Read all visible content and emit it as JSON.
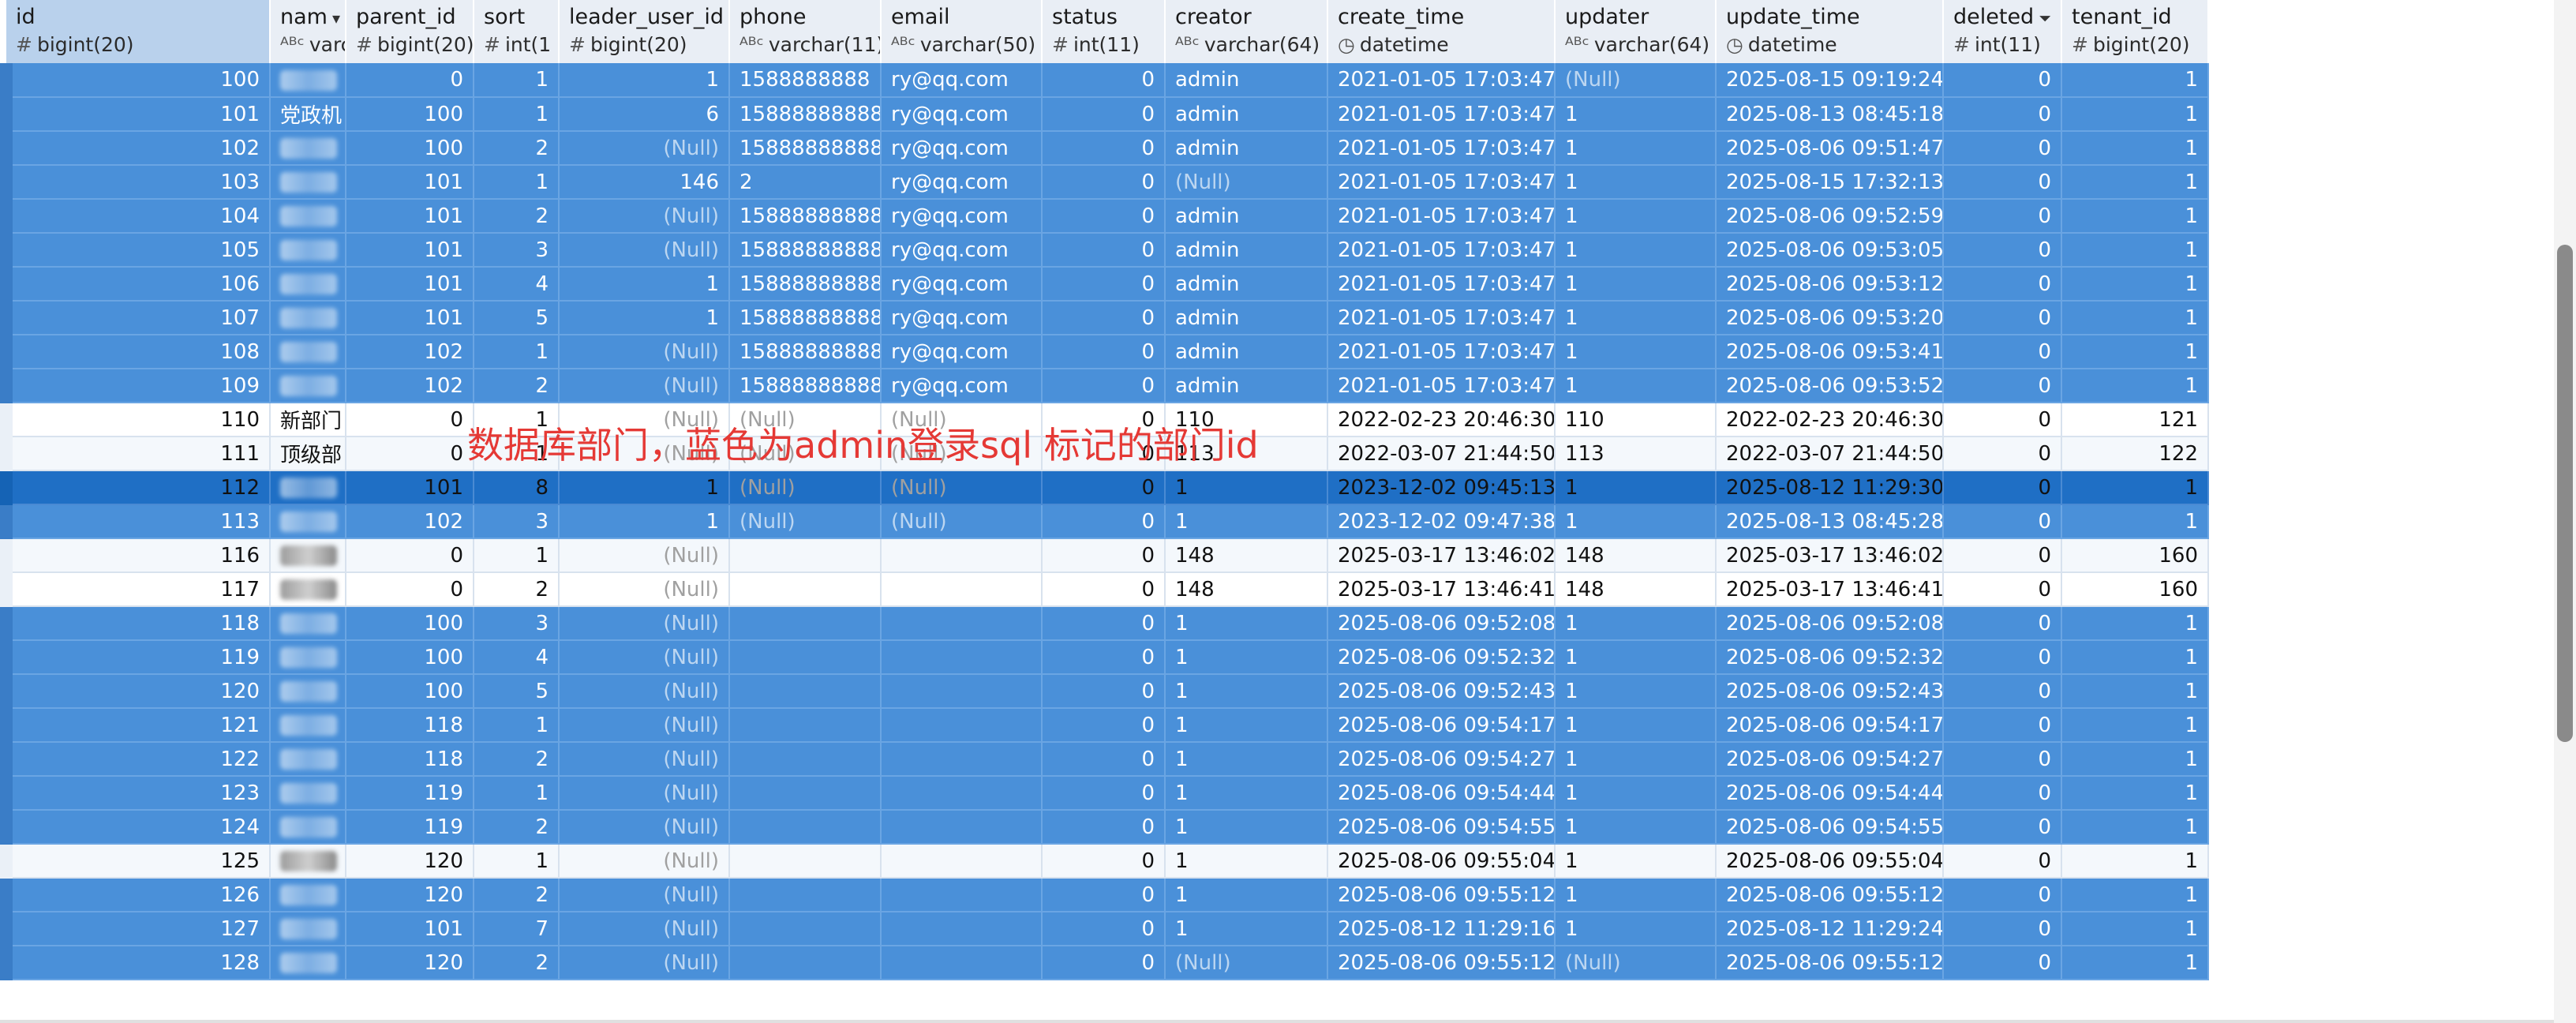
{
  "columns": [
    {
      "name": "id",
      "type": "bigint(20)",
      "type_icon": "#"
    },
    {
      "name": "nam",
      "type": "varc",
      "type_icon": "ABC",
      "sort_indicator": "sort-desc-icon"
    },
    {
      "name": "parent_id",
      "type": "bigint(20)",
      "type_icon": "#"
    },
    {
      "name": "sort",
      "type": "int(1",
      "type_icon": "#"
    },
    {
      "name": "leader_user_id",
      "type": "bigint(20)",
      "type_icon": "#"
    },
    {
      "name": "phone",
      "type": "varchar(11)",
      "type_icon": "ABC"
    },
    {
      "name": "email",
      "type": "varchar(50)",
      "type_icon": "ABC"
    },
    {
      "name": "status",
      "type": "int(11)",
      "type_icon": "#"
    },
    {
      "name": "creator",
      "type": "varchar(64)",
      "type_icon": "ABC"
    },
    {
      "name": "create_time",
      "type": "datetime",
      "type_icon": "clock"
    },
    {
      "name": "updater",
      "type": "varchar(64)",
      "type_icon": "ABC"
    },
    {
      "name": "update_time",
      "type": "datetime",
      "type_icon": "clock"
    },
    {
      "name": "deleted",
      "type": "int(11)",
      "type_icon": "#",
      "filter_indicator": "filter-icon"
    },
    {
      "name": "tenant_id",
      "type": "bigint(20)",
      "type_icon": "#"
    }
  ],
  "rows": [
    {
      "s": "sel",
      "c": [
        "100",
        "",
        "0",
        "1",
        "1",
        "1588888888",
        "ry@qq.com",
        "0",
        "admin",
        "2021-01-05 17:03:47",
        "(Null)",
        "2025-08-15 09:19:24",
        "0",
        "1"
      ]
    },
    {
      "s": "sel",
      "c": [
        "101",
        "党政机",
        "100",
        "1",
        "6",
        "15888888888",
        "ry@qq.com",
        "0",
        "admin",
        "2021-01-05 17:03:47",
        "1",
        "2025-08-13 08:45:18",
        "0",
        "1"
      ]
    },
    {
      "s": "sel",
      "c": [
        "102",
        "",
        "100",
        "2",
        "(Null)",
        "15888888888",
        "ry@qq.com",
        "0",
        "admin",
        "2021-01-05 17:03:47",
        "1",
        "2025-08-06 09:51:47",
        "0",
        "1"
      ]
    },
    {
      "s": "sel",
      "c": [
        "103",
        "",
        "101",
        "1",
        "146",
        "2",
        "ry@qq.com",
        "0",
        "(Null)",
        "2021-01-05 17:03:47",
        "1",
        "2025-08-15 17:32:13",
        "0",
        "1"
      ]
    },
    {
      "s": "sel",
      "c": [
        "104",
        "",
        "101",
        "2",
        "(Null)",
        "15888888888",
        "ry@qq.com",
        "0",
        "admin",
        "2021-01-05 17:03:47",
        "1",
        "2025-08-06 09:52:59",
        "0",
        "1"
      ]
    },
    {
      "s": "sel",
      "c": [
        "105",
        "",
        "101",
        "3",
        "(Null)",
        "15888888888",
        "ry@qq.com",
        "0",
        "admin",
        "2021-01-05 17:03:47",
        "1",
        "2025-08-06 09:53:05",
        "0",
        "1"
      ]
    },
    {
      "s": "sel",
      "c": [
        "106",
        "",
        "101",
        "4",
        "1",
        "15888888888",
        "ry@qq.com",
        "0",
        "admin",
        "2021-01-05 17:03:47",
        "1",
        "2025-08-06 09:53:12",
        "0",
        "1"
      ]
    },
    {
      "s": "sel",
      "c": [
        "107",
        "",
        "101",
        "5",
        "1",
        "15888888888",
        "ry@qq.com",
        "0",
        "admin",
        "2021-01-05 17:03:47",
        "1",
        "2025-08-06 09:53:20",
        "0",
        "1"
      ]
    },
    {
      "s": "sel",
      "c": [
        "108",
        "",
        "102",
        "1",
        "(Null)",
        "15888888888",
        "ry@qq.com",
        "0",
        "admin",
        "2021-01-05 17:03:47",
        "1",
        "2025-08-06 09:53:41",
        "0",
        "1"
      ]
    },
    {
      "s": "sel",
      "c": [
        "109",
        "",
        "102",
        "2",
        "(Null)",
        "15888888888",
        "ry@qq.com",
        "0",
        "admin",
        "2021-01-05 17:03:47",
        "1",
        "2025-08-06 09:53:52",
        "0",
        "1"
      ]
    },
    {
      "s": "plain",
      "c": [
        "110",
        "新部门",
        "0",
        "1",
        "(Null)",
        "(Null)",
        "(Null)",
        "0",
        "110",
        "2022-02-23 20:46:30",
        "110",
        "2022-02-23 20:46:30",
        "0",
        "121"
      ]
    },
    {
      "s": "plainalt",
      "c": [
        "111",
        "顶级部",
        "0",
        "1",
        "(Null)",
        "(Null)",
        "(Null)",
        "0",
        "113",
        "2022-03-07 21:44:50",
        "113",
        "2022-03-07 21:44:50",
        "0",
        "122"
      ]
    },
    {
      "s": "cur",
      "c": [
        "112",
        "",
        "101",
        "8",
        "1",
        "(Null)",
        "(Null)",
        "0",
        "1",
        "2023-12-02 09:45:13",
        "1",
        "2025-08-12 11:29:30",
        "0",
        "1"
      ]
    },
    {
      "s": "sel",
      "c": [
        "113",
        "",
        "102",
        "3",
        "1",
        "(Null)",
        "(Null)",
        "0",
        "1",
        "2023-12-02 09:47:38",
        "1",
        "2025-08-13 08:45:28",
        "0",
        "1"
      ]
    },
    {
      "s": "plainalt",
      "c": [
        "116",
        "",
        "0",
        "1",
        "(Null)",
        "",
        "",
        "0",
        "148",
        "2025-03-17 13:46:02",
        "148",
        "2025-03-17 13:46:02",
        "0",
        "160"
      ]
    },
    {
      "s": "plain",
      "c": [
        "117",
        "",
        "0",
        "2",
        "(Null)",
        "",
        "",
        "0",
        "148",
        "2025-03-17 13:46:41",
        "148",
        "2025-03-17 13:46:41",
        "0",
        "160"
      ]
    },
    {
      "s": "sel",
      "c": [
        "118",
        "",
        "100",
        "3",
        "(Null)",
        "",
        "",
        "0",
        "1",
        "2025-08-06 09:52:08",
        "1",
        "2025-08-06 09:52:08",
        "0",
        "1"
      ]
    },
    {
      "s": "sel",
      "c": [
        "119",
        "",
        "100",
        "4",
        "(Null)",
        "",
        "",
        "0",
        "1",
        "2025-08-06 09:52:32",
        "1",
        "2025-08-06 09:52:32",
        "0",
        "1"
      ]
    },
    {
      "s": "sel",
      "c": [
        "120",
        "",
        "100",
        "5",
        "(Null)",
        "",
        "",
        "0",
        "1",
        "2025-08-06 09:52:43",
        "1",
        "2025-08-06 09:52:43",
        "0",
        "1"
      ]
    },
    {
      "s": "sel",
      "c": [
        "121",
        "",
        "118",
        "1",
        "(Null)",
        "",
        "",
        "0",
        "1",
        "2025-08-06 09:54:17",
        "1",
        "2025-08-06 09:54:17",
        "0",
        "1"
      ]
    },
    {
      "s": "sel",
      "c": [
        "122",
        "",
        "118",
        "2",
        "(Null)",
        "",
        "",
        "0",
        "1",
        "2025-08-06 09:54:27",
        "1",
        "2025-08-06 09:54:27",
        "0",
        "1"
      ]
    },
    {
      "s": "sel",
      "c": [
        "123",
        "",
        "119",
        "1",
        "(Null)",
        "",
        "",
        "0",
        "1",
        "2025-08-06 09:54:44",
        "1",
        "2025-08-06 09:54:44",
        "0",
        "1"
      ]
    },
    {
      "s": "sel",
      "c": [
        "124",
        "",
        "119",
        "2",
        "(Null)",
        "",
        "",
        "0",
        "1",
        "2025-08-06 09:54:55",
        "1",
        "2025-08-06 09:54:55",
        "0",
        "1"
      ]
    },
    {
      "s": "plainalt",
      "c": [
        "125",
        "",
        "120",
        "1",
        "(Null)",
        "",
        "",
        "0",
        "1",
        "2025-08-06 09:55:04",
        "1",
        "2025-08-06 09:55:04",
        "0",
        "1"
      ]
    },
    {
      "s": "sel",
      "c": [
        "126",
        "",
        "120",
        "2",
        "(Null)",
        "",
        "",
        "0",
        "1",
        "2025-08-06 09:55:12",
        "1",
        "2025-08-06 09:55:12",
        "0",
        "1"
      ]
    },
    {
      "s": "sel",
      "c": [
        "127",
        "",
        "101",
        "7",
        "(Null)",
        "",
        "",
        "0",
        "1",
        "2025-08-12 11:29:16",
        "1",
        "2025-08-12 11:29:24",
        "0",
        "1"
      ]
    },
    {
      "s": "sel",
      "c": [
        "128",
        "",
        "120",
        "2",
        "(Null)",
        "",
        "",
        "0",
        "(Null)",
        "2025-08-06 09:55:12",
        "(Null)",
        "2025-08-06 09:55:12",
        "0",
        "1"
      ]
    }
  ],
  "annotation": "数据库部门，蓝色为admin登录sql 标记的部门id",
  "colors": {
    "selected_row": "#4a90d9",
    "current_row": "#1f6fc5",
    "annotation": "#e53935",
    "header": "#e9eef5"
  }
}
